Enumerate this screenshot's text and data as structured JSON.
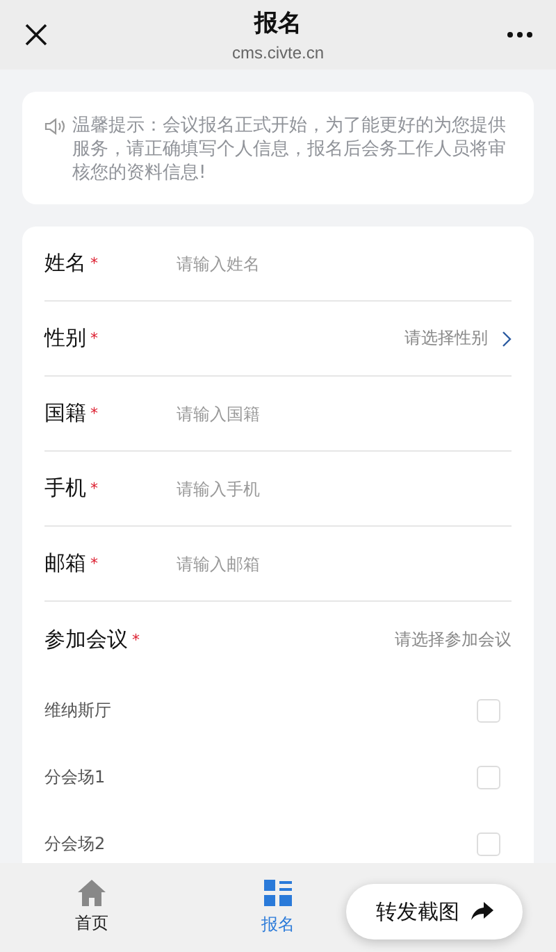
{
  "header": {
    "title": "报名",
    "subtitle": "cms.civte.cn"
  },
  "notice": {
    "text": "温馨提示：会议报名正式开始，为了能更好的为您提供服务，请正确填写个人信息，报名后会务工作人员将审核您的资料信息!"
  },
  "fields": [
    {
      "kind": "input",
      "label": "姓名",
      "required_mark": "*",
      "placeholder": "请输入姓名"
    },
    {
      "kind": "select",
      "label": "性别",
      "required_mark": "*",
      "placeholder": "请选择性别"
    },
    {
      "kind": "input",
      "label": "国籍",
      "required_mark": "*",
      "placeholder": "请输入国籍"
    },
    {
      "kind": "input",
      "label": "手机",
      "required_mark": "*",
      "placeholder": "请输入手机"
    },
    {
      "kind": "input",
      "label": "邮箱",
      "required_mark": "*",
      "placeholder": "请输入邮箱"
    }
  ],
  "meetings": {
    "label": "参加会议",
    "required_mark": "*",
    "hint": "请选择参加会议",
    "options": [
      {
        "label": "维纳斯厅",
        "checked": false
      },
      {
        "label": "分会场1",
        "checked": false
      },
      {
        "label": "分会场2",
        "checked": false
      }
    ]
  },
  "tabs": [
    {
      "kind": "home",
      "label": "首页",
      "selected": false
    },
    {
      "kind": "signup",
      "label": "报名",
      "selected": true
    }
  ],
  "share_button": {
    "label": "转发截图"
  }
}
